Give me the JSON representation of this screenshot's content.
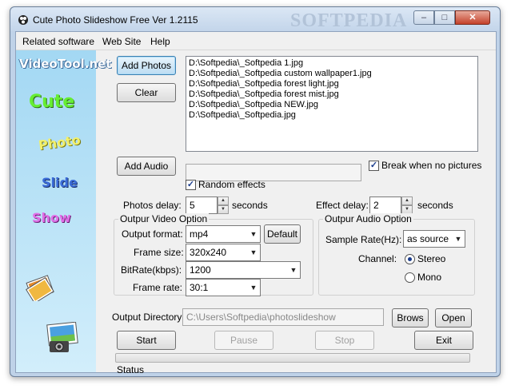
{
  "window": {
    "title": "Cute Photo Slideshow Free Ver 1.2115",
    "watermark": "SOFTPEDIA",
    "minimize_glyph": "–",
    "maximize_glyph": "□",
    "close_glyph": "✕"
  },
  "menu": {
    "items": [
      {
        "label": "Related software"
      },
      {
        "label": "Web Site"
      },
      {
        "label": "Help"
      }
    ]
  },
  "sidebar": {
    "brand": "VideoTool.net",
    "words": [
      "Cute",
      "Photo",
      "Slide",
      "Show"
    ],
    "icons": [
      "photos-icon",
      "camera-icon"
    ]
  },
  "photos": {
    "add_label": "Add Photos",
    "clear_label": "Clear",
    "list": [
      "D:\\Softpedia\\_Softpedia 1.jpg",
      "D:\\Softpedia\\_Softpedia custom wallpaper1.jpg",
      "D:\\Softpedia\\_Softpedia forest light.jpg",
      "D:\\Softpedia\\_Softpedia forest mist.jpg",
      "D:\\Softpedia\\_Softpedia NEW.jpg",
      "D:\\Softpedia\\_Softpedia.jpg"
    ]
  },
  "audio": {
    "add_label": "Add Audio",
    "path_value": "",
    "break_label": "Break when no pictures",
    "break_checked": true,
    "random_label": "Random effects",
    "random_checked": true
  },
  "delays": {
    "photos_label": "Photos delay:",
    "photos_value": "5",
    "photos_unit": "seconds",
    "effect_label": "Effect delay:",
    "effect_value": "2",
    "effect_unit": "seconds"
  },
  "video": {
    "group_label": "Outpur Video Option",
    "format_label": "Output format:",
    "format_value": "mp4",
    "default_label": "Default",
    "size_label": "Frame size:",
    "size_value": "320x240",
    "bitrate_label": "BitRate(kbps):",
    "bitrate_value": "1200",
    "rate_label": "Frame rate:",
    "rate_value": "30:1"
  },
  "audio_options": {
    "group_label": "Outpur Audio Option",
    "sample_label": "Sample Rate(Hz):",
    "sample_value": "as source",
    "channel_label": "Channel:",
    "stereo_label": "Stereo",
    "mono_label": "Mono",
    "selected": "Stereo"
  },
  "output": {
    "dir_label": "Output Directory:",
    "dir_value": "C:\\Users\\Softpedia\\photoslideshow",
    "browse_label": "Brows",
    "open_label": "Open"
  },
  "actions": {
    "start_label": "Start",
    "pause_label": "Pause",
    "stop_label": "Stop",
    "exit_label": "Exit"
  },
  "status": {
    "label": "Status",
    "progress": 0
  },
  "colors": {
    "window_frame": "#bfd2e8",
    "client": "#f0f0f0",
    "sidebar_top": "#a3d8f3",
    "close_button": "#c4412a"
  }
}
